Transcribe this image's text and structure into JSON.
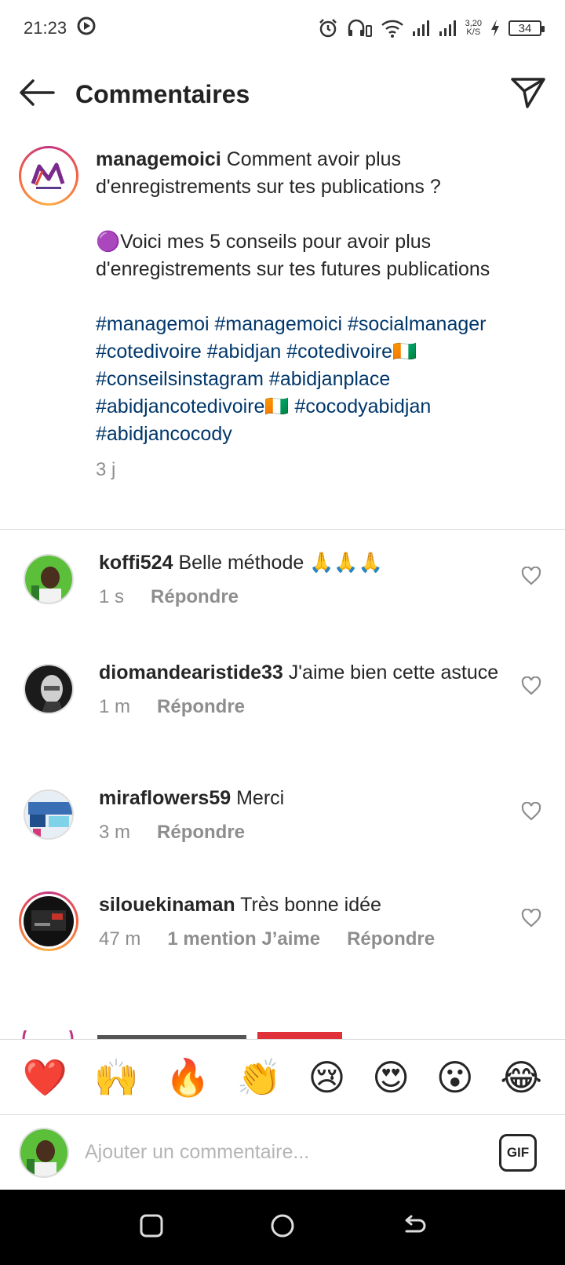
{
  "status_bar": {
    "time": "21:23",
    "net_speed_value": "3,20",
    "net_speed_unit": "K/S",
    "battery": "34"
  },
  "header": {
    "title": "Commentaires"
  },
  "caption": {
    "username": "managemoici",
    "line1": "Comment avoir plus d'enregistrements sur tes publications ?",
    "line2_emoji": "🟣",
    "line2": "Voici mes 5 conseils pour avoir plus d'enregistrements sur tes futures publications",
    "hashtags": "#managemoi #managemoici #socialmanager #cotedivoire #abidjan #cotedivoire🇨🇮 #conseilsinstagram #abidjanplace #abidjancotedivoire🇨🇮 #cocodyabidjan #abidjancocody",
    "time": "3 j"
  },
  "comments": [
    {
      "username": "koffi524",
      "text": "Belle méthode 🙏🙏🙏",
      "time": "1 s",
      "likes": "",
      "reply": "Répondre"
    },
    {
      "username": "diomandearistide33",
      "text": "J'aime bien cette astuce",
      "time": "1 m",
      "likes": "",
      "reply": "Répondre"
    },
    {
      "username": "miraflowers59",
      "text": "Merci",
      "time": "3 m",
      "likes": "",
      "reply": "Répondre"
    },
    {
      "username": "silouekinaman",
      "text": "Très bonne idée",
      "time": "47 m",
      "likes": "1 mention J’aime",
      "reply": "Répondre"
    }
  ],
  "emoji_bar": [
    "❤️",
    "🙌",
    "🔥",
    "👏",
    "😢",
    "😍",
    "😮",
    "😂"
  ],
  "input": {
    "placeholder": "Ajouter un commentaire...",
    "gif_label": "GIF"
  },
  "colors": {
    "hashtag": "#00376b",
    "secondary_text": "#8e8e8e",
    "divider": "#dbdbdb"
  }
}
